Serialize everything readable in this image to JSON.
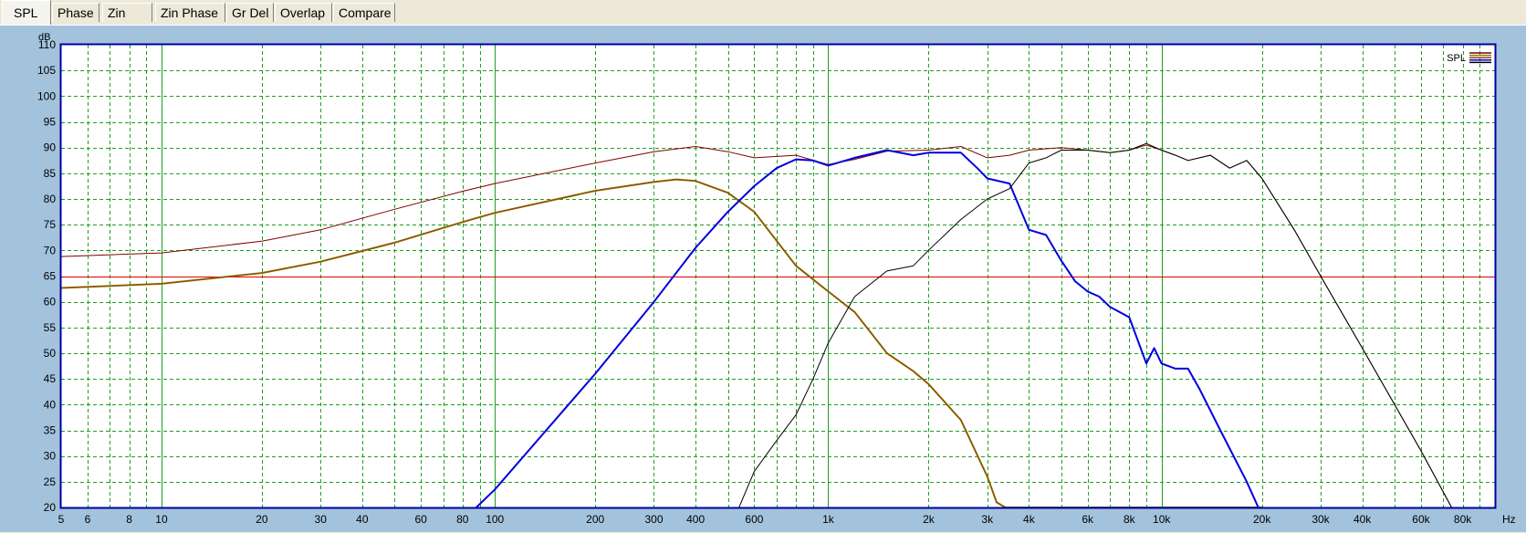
{
  "tabs": [
    {
      "label": "SPL",
      "active": true
    },
    {
      "label": "Phase",
      "active": false
    },
    {
      "label": "Zin",
      "active": false
    },
    {
      "label": "Zin Phase",
      "active": false
    },
    {
      "label": "Gr Del",
      "active": false
    },
    {
      "label": "Overlap",
      "active": false
    },
    {
      "label": "Compare",
      "active": false
    }
  ],
  "chart_data": {
    "type": "line",
    "xscale": "log",
    "yunit": "dB",
    "xunit": "Hz",
    "xlim": [
      5,
      100000
    ],
    "ylim": [
      20,
      110
    ],
    "grid": true,
    "legend": {
      "label": "SPL",
      "placement": "top-right"
    },
    "xticks": [
      {
        "v": 5,
        "label": "5"
      },
      {
        "v": 6,
        "label": "6"
      },
      {
        "v": 8,
        "label": "8"
      },
      {
        "v": 10,
        "label": "10"
      },
      {
        "v": 20,
        "label": "20"
      },
      {
        "v": 30,
        "label": "30"
      },
      {
        "v": 40,
        "label": "40"
      },
      {
        "v": 60,
        "label": "60"
      },
      {
        "v": 80,
        "label": "80"
      },
      {
        "v": 100,
        "label": "100"
      },
      {
        "v": 200,
        "label": "200"
      },
      {
        "v": 300,
        "label": "300"
      },
      {
        "v": 400,
        "label": "400"
      },
      {
        "v": 600,
        "label": "600"
      },
      {
        "v": 1000,
        "label": "1k"
      },
      {
        "v": 2000,
        "label": "2k"
      },
      {
        "v": 3000,
        "label": "3k"
      },
      {
        "v": 4000,
        "label": "4k"
      },
      {
        "v": 6000,
        "label": "6k"
      },
      {
        "v": 8000,
        "label": "8k"
      },
      {
        "v": 10000,
        "label": "10k"
      },
      {
        "v": 20000,
        "label": "20k"
      },
      {
        "v": 30000,
        "label": "30k"
      },
      {
        "v": 40000,
        "label": "40k"
      },
      {
        "v": 60000,
        "label": "60k"
      },
      {
        "v": 80000,
        "label": "80k"
      }
    ],
    "yticks": [
      20,
      25,
      30,
      35,
      40,
      45,
      50,
      55,
      60,
      65,
      70,
      75,
      80,
      85,
      90,
      95,
      100,
      105,
      110
    ],
    "reference_line": {
      "y": 65,
      "color": "#e00000"
    },
    "series": [
      {
        "color": "#800000",
        "width": 1,
        "points": [
          [
            5,
            68.8
          ],
          [
            10,
            69.5
          ],
          [
            20,
            71.8
          ],
          [
            30,
            74
          ],
          [
            50,
            78
          ],
          [
            80,
            81.5
          ],
          [
            100,
            83
          ],
          [
            200,
            87
          ],
          [
            300,
            89.2
          ],
          [
            400,
            90.2
          ],
          [
            500,
            89.2
          ],
          [
            600,
            88
          ],
          [
            800,
            88.5
          ],
          [
            1000,
            86.7
          ],
          [
            1200,
            87.7
          ],
          [
            1500,
            89.3
          ],
          [
            2000,
            89.5
          ],
          [
            2500,
            90.2
          ],
          [
            3000,
            88
          ],
          [
            3500,
            88.5
          ],
          [
            4000,
            89.5
          ],
          [
            5000,
            90
          ],
          [
            6000,
            89.5
          ],
          [
            7000,
            89
          ],
          [
            8000,
            89.5
          ],
          [
            9000,
            90.5
          ],
          [
            10000,
            89.5
          ],
          [
            11000,
            88.5
          ],
          [
            12000,
            87.5
          ],
          [
            14000,
            88.5
          ],
          [
            16000,
            86
          ],
          [
            18000,
            87.5
          ],
          [
            20000,
            84
          ],
          [
            25000,
            74
          ],
          [
            30000,
            65
          ],
          [
            40000,
            51
          ],
          [
            60000,
            31
          ],
          [
            70000,
            23
          ],
          [
            80000,
            16
          ]
        ]
      },
      {
        "color": "#808000",
        "width": 2,
        "points": [
          [
            5,
            62.7
          ],
          [
            10,
            63.5
          ],
          [
            20,
            65.6
          ],
          [
            30,
            67.8
          ],
          [
            50,
            71.5
          ],
          [
            80,
            75.5
          ],
          [
            100,
            77.3
          ],
          [
            200,
            81.6
          ],
          [
            300,
            83.3
          ],
          [
            350,
            83.8
          ],
          [
            400,
            83.5
          ],
          [
            500,
            81.2
          ],
          [
            600,
            77.5
          ],
          [
            800,
            67
          ],
          [
            1000,
            62
          ],
          [
            1200,
            58
          ],
          [
            1500,
            50
          ],
          [
            1800,
            46.5
          ],
          [
            2000,
            44
          ],
          [
            2500,
            37
          ],
          [
            3000,
            26
          ],
          [
            3200,
            21
          ],
          [
            3400,
            20
          ],
          [
            20000,
            20
          ]
        ]
      },
      {
        "color": "#a04000",
        "width": 1,
        "points": [
          [
            5,
            62.7
          ],
          [
            10,
            63.5
          ],
          [
            20,
            65.6
          ],
          [
            30,
            67.8
          ],
          [
            50,
            71.5
          ],
          [
            80,
            75.5
          ],
          [
            100,
            77.3
          ],
          [
            200,
            81.6
          ],
          [
            300,
            83.3
          ],
          [
            350,
            83.8
          ],
          [
            400,
            83.5
          ],
          [
            500,
            81.2
          ],
          [
            600,
            77.5
          ],
          [
            800,
            67
          ],
          [
            1000,
            62
          ],
          [
            1200,
            58
          ],
          [
            1500,
            50
          ],
          [
            1800,
            46.5
          ],
          [
            2000,
            44
          ],
          [
            2500,
            37
          ],
          [
            3000,
            26
          ],
          [
            3200,
            21
          ],
          [
            3400,
            20
          ],
          [
            20000,
            20
          ]
        ]
      },
      {
        "color": "#0000e0",
        "width": 2,
        "points": [
          [
            88,
            20
          ],
          [
            100,
            23.5
          ],
          [
            200,
            46
          ],
          [
            300,
            60
          ],
          [
            400,
            70.5
          ],
          [
            500,
            77.5
          ],
          [
            600,
            82.5
          ],
          [
            700,
            86
          ],
          [
            800,
            87.7
          ],
          [
            900,
            87.5
          ],
          [
            1000,
            86.5
          ],
          [
            1200,
            88
          ],
          [
            1500,
            89.5
          ],
          [
            1800,
            88.5
          ],
          [
            2000,
            89
          ],
          [
            2500,
            89
          ],
          [
            2800,
            86
          ],
          [
            3000,
            84
          ],
          [
            3500,
            83
          ],
          [
            4000,
            74
          ],
          [
            4500,
            73
          ],
          [
            5000,
            68
          ],
          [
            5500,
            64
          ],
          [
            6000,
            62
          ],
          [
            6500,
            61
          ],
          [
            7000,
            59
          ],
          [
            8000,
            57
          ],
          [
            9000,
            48
          ],
          [
            9500,
            51
          ],
          [
            10000,
            48
          ],
          [
            11000,
            47
          ],
          [
            12000,
            47
          ],
          [
            13000,
            43
          ],
          [
            15000,
            35
          ],
          [
            18000,
            25
          ],
          [
            19500,
            20
          ]
        ]
      },
      {
        "color": "#000000",
        "width": 1,
        "points": [
          [
            540,
            20
          ],
          [
            600,
            27
          ],
          [
            700,
            33
          ],
          [
            800,
            38
          ],
          [
            900,
            45
          ],
          [
            1000,
            52
          ],
          [
            1200,
            61
          ],
          [
            1500,
            66
          ],
          [
            1800,
            67
          ],
          [
            2000,
            70
          ],
          [
            2500,
            76
          ],
          [
            3000,
            80
          ],
          [
            3500,
            82
          ],
          [
            4000,
            87
          ],
          [
            4500,
            88
          ],
          [
            5000,
            89.5
          ],
          [
            6000,
            89.5
          ],
          [
            7000,
            89
          ],
          [
            8000,
            89.5
          ],
          [
            9000,
            90.8
          ],
          [
            10000,
            89.5
          ],
          [
            11000,
            88.5
          ],
          [
            12000,
            87.5
          ],
          [
            14000,
            88.5
          ],
          [
            16000,
            86
          ],
          [
            18000,
            87.5
          ],
          [
            20000,
            84
          ],
          [
            25000,
            74
          ],
          [
            30000,
            65
          ],
          [
            40000,
            51
          ],
          [
            60000,
            31
          ],
          [
            70000,
            23
          ],
          [
            80000,
            16
          ]
        ]
      }
    ]
  }
}
